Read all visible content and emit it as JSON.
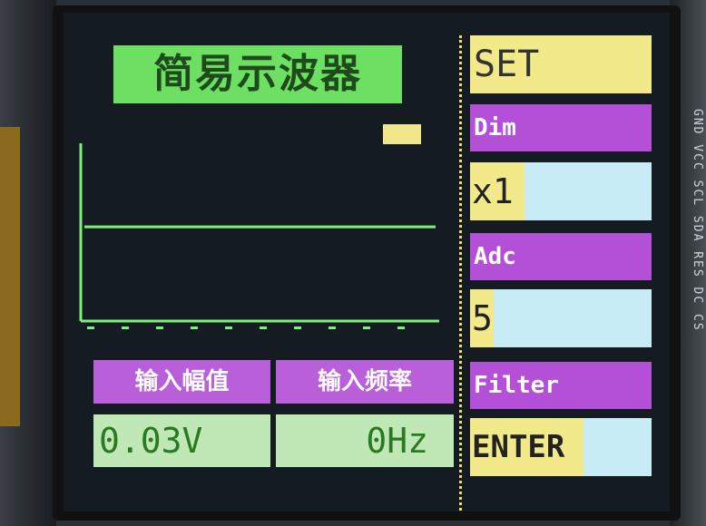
{
  "display": {
    "title": "简易示波器",
    "amplitude_label": "输入幅值",
    "frequency_label": "输入频率",
    "amplitude_value": "0.03V",
    "frequency_value": "0Hz",
    "trace_level": 0.47
  },
  "menu": {
    "set": "SET",
    "dim": "Dim",
    "dim_value": "x1",
    "adc": "Adc",
    "adc_value": "5",
    "filter": "Filter",
    "enter": "ENTER"
  },
  "board": {
    "pin_labels": "GND VCC SCL SDA RES DC CS"
  },
  "colors": {
    "screen_bg": "#141c22",
    "trace": "#7df07a",
    "title_bg": "#6ddf62",
    "label_bg": "#b85fd9",
    "value_bg": "#bfe8b6",
    "menu_yellow": "#f1e98a",
    "menu_purple": "#b44fd8",
    "menu_cyan": "#c7ecf6"
  }
}
